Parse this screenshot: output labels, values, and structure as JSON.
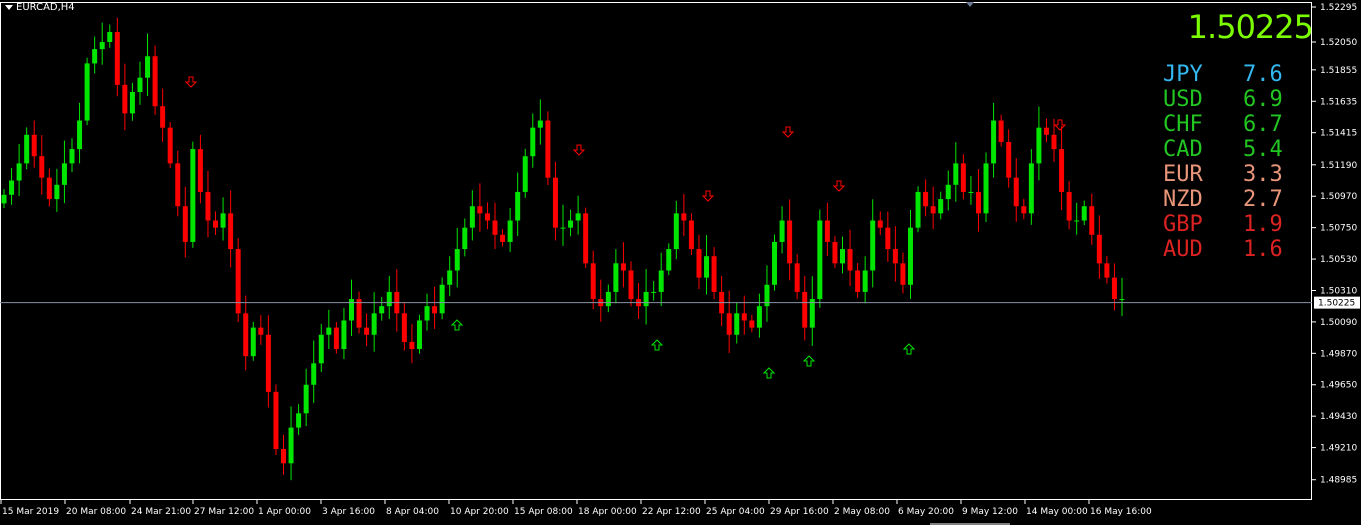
{
  "symbol": "EURCAD,H4",
  "current_price": "1.50225",
  "currency_strength": [
    {
      "currency": "JPY",
      "value": "7.6",
      "color": "#33b8f0"
    },
    {
      "currency": "USD",
      "value": "6.9",
      "color": "#22c622"
    },
    {
      "currency": "CHF",
      "value": "6.7",
      "color": "#22c622"
    },
    {
      "currency": "CAD",
      "value": "5.4",
      "color": "#22c622"
    },
    {
      "currency": "EUR",
      "value": "3.3",
      "color": "#e9967a"
    },
    {
      "currency": "NZD",
      "value": "2.7",
      "color": "#e9967a"
    },
    {
      "currency": "GBP",
      "value": "1.9",
      "color": "#dd2222"
    },
    {
      "currency": "AUD",
      "value": "1.6",
      "color": "#dd2222"
    }
  ],
  "colors": {
    "bull": "#00e600",
    "bear": "#ff0000",
    "grid": "#ffffff",
    "price_line": "#8a93a8"
  },
  "chart_data": {
    "type": "candlestick",
    "ylim": [
      1.4885,
      1.5233
    ],
    "y_ticks": [
      "1.52295",
      "1.52050",
      "1.51855",
      "1.51635",
      "1.51415",
      "1.51190",
      "1.50970",
      "1.50750",
      "1.50530",
      "1.50310",
      "1.50090",
      "1.49870",
      "1.49650",
      "1.49430",
      "1.49210",
      "1.48985"
    ],
    "current_price_tag": "1.50225",
    "current_price_value": 1.50225,
    "x_labels": [
      "15 Mar 2019",
      "20 Mar 08:00",
      "24 Mar 21:00",
      "27 Mar 12:00",
      "1 Apr 00:00",
      "3 Apr 16:00",
      "8 Apr 04:00",
      "10 Apr 20:00",
      "15 Apr 08:00",
      "18 Apr 00:00",
      "22 Apr 12:00",
      "25 Apr 04:00",
      "29 Apr 16:00",
      "2 May 08:00",
      "6 May 20:00",
      "9 May 12:00",
      "14 May 00:00",
      "16 May 16:00"
    ],
    "closes": [
      1.5098,
      1.5108,
      1.512,
      1.514,
      1.5125,
      1.511,
      1.5095,
      1.5105,
      1.512,
      1.513,
      1.515,
      1.519,
      1.52,
      1.5205,
      1.5212,
      1.5175,
      1.5155,
      1.517,
      1.518,
      1.5195,
      1.516,
      1.5145,
      1.512,
      1.509,
      1.5065,
      1.513,
      1.51,
      1.508,
      1.5075,
      1.5085,
      1.506,
      1.5015,
      1.4985,
      1.5005,
      1.5,
      1.496,
      1.492,
      1.491,
      1.4935,
      1.4945,
      1.4965,
      1.498,
      1.5,
      1.5005,
      1.499,
      1.501,
      1.5025,
      1.5005,
      1.5,
      1.5015,
      1.502,
      1.503,
      1.5015,
      1.4995,
      1.499,
      1.501,
      1.502,
      1.5015,
      1.5035,
      1.5045,
      1.506,
      1.5075,
      1.509,
      1.5085,
      1.508,
      1.507,
      1.5065,
      1.508,
      1.51,
      1.5125,
      1.5145,
      1.515,
      1.511,
      1.5075,
      1.5075,
      1.508,
      1.5085,
      1.505,
      1.5025,
      1.502,
      1.503,
      1.505,
      1.5045,
      1.5025,
      1.502,
      1.503,
      1.503,
      1.5045,
      1.506,
      1.5085,
      1.508,
      1.506,
      1.504,
      1.5055,
      1.503,
      1.5015,
      1.5,
      1.5015,
      1.501,
      1.5005,
      1.502,
      1.5035,
      1.5065,
      1.508,
      1.505,
      1.503,
      1.5005,
      1.5025,
      1.508,
      1.5065,
      1.505,
      1.506,
      1.5045,
      1.503,
      1.5045,
      1.508,
      1.5075,
      1.506,
      1.505,
      1.5035,
      1.5075,
      1.51,
      1.509,
      1.5085,
      1.5095,
      1.5105,
      1.512,
      1.51,
      1.51,
      1.5085,
      1.512,
      1.515,
      1.5135,
      1.511,
      1.509,
      1.5085,
      1.512,
      1.5145,
      1.514,
      1.513,
      1.51,
      1.508,
      1.508,
      1.509,
      1.507,
      1.505,
      1.504,
      1.5025,
      1.5025
    ]
  }
}
